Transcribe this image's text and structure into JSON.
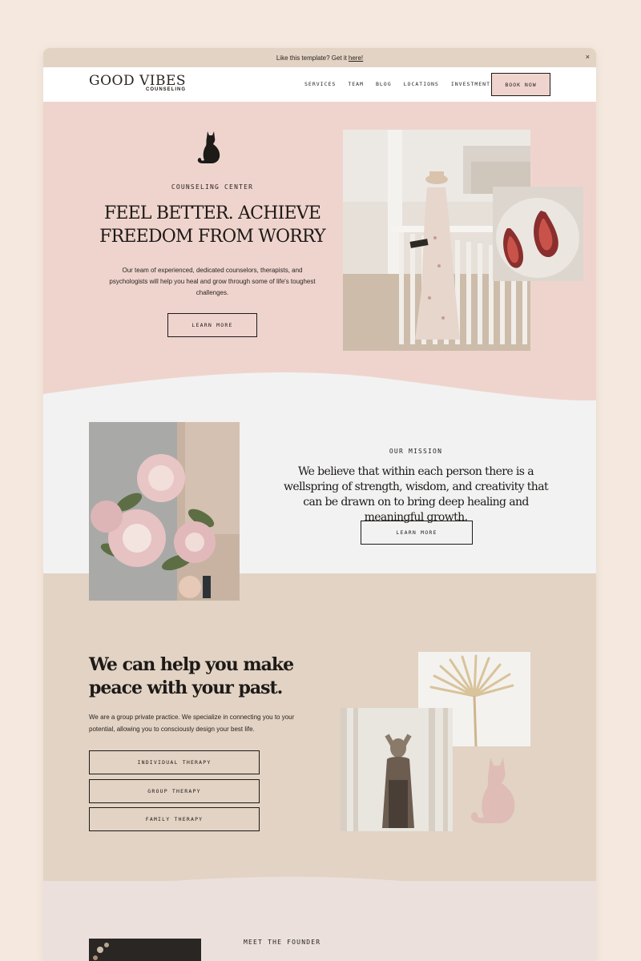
{
  "announcement": {
    "text": "Like this template? Get it",
    "link": " here!",
    "close": "×"
  },
  "nav": {
    "logo_main": "GOOD VIBES",
    "logo_sub": "COUNSELING",
    "items": [
      "SERVICES",
      "TEAM",
      "BLOG",
      "LOCATIONS",
      "INVESTMENT"
    ],
    "cta": "BOOK NOW"
  },
  "hero": {
    "eyebrow": "COUNSELING CENTER",
    "title": "FEEL BETTER. ACHIEVE FREEDOM FROM WORRY",
    "body": "Our team of experienced, dedicated counselors, therapists, and psychologists will help you heal and grow through some of life's toughest challenges.",
    "button": "LEARN MORE"
  },
  "mission": {
    "eyebrow": "OUR MISSION",
    "text": "We believe that within each person there is a wellspring of strength, wisdom, and creativity that can be drawn on to bring deep healing and meaningful growth.",
    "button": "LEARN MORE"
  },
  "services": {
    "title": "We can help you make peace with your past.",
    "body": "We are a group private practice. We specialize in connecting you to your potential, allowing you to consciously design your best life.",
    "buttons": [
      "INDIVIDUAL THERAPY",
      "GROUP THERAPY",
      "FAMILY THERAPY"
    ]
  },
  "founder": {
    "eyebrow": "MEET THE FOUNDER"
  },
  "colors": {
    "page_bg": "#f5e9df",
    "blush": "#efd4cd",
    "sand": "#e2d3c4",
    "light_gray": "#f2f2f2",
    "ink": "#1d1a18",
    "cat_pink": "#dfbcb6"
  },
  "icons": {
    "hero_cat": "cat-silhouette-icon",
    "services_cat": "cat-silhouette-icon",
    "close": "close-icon"
  }
}
